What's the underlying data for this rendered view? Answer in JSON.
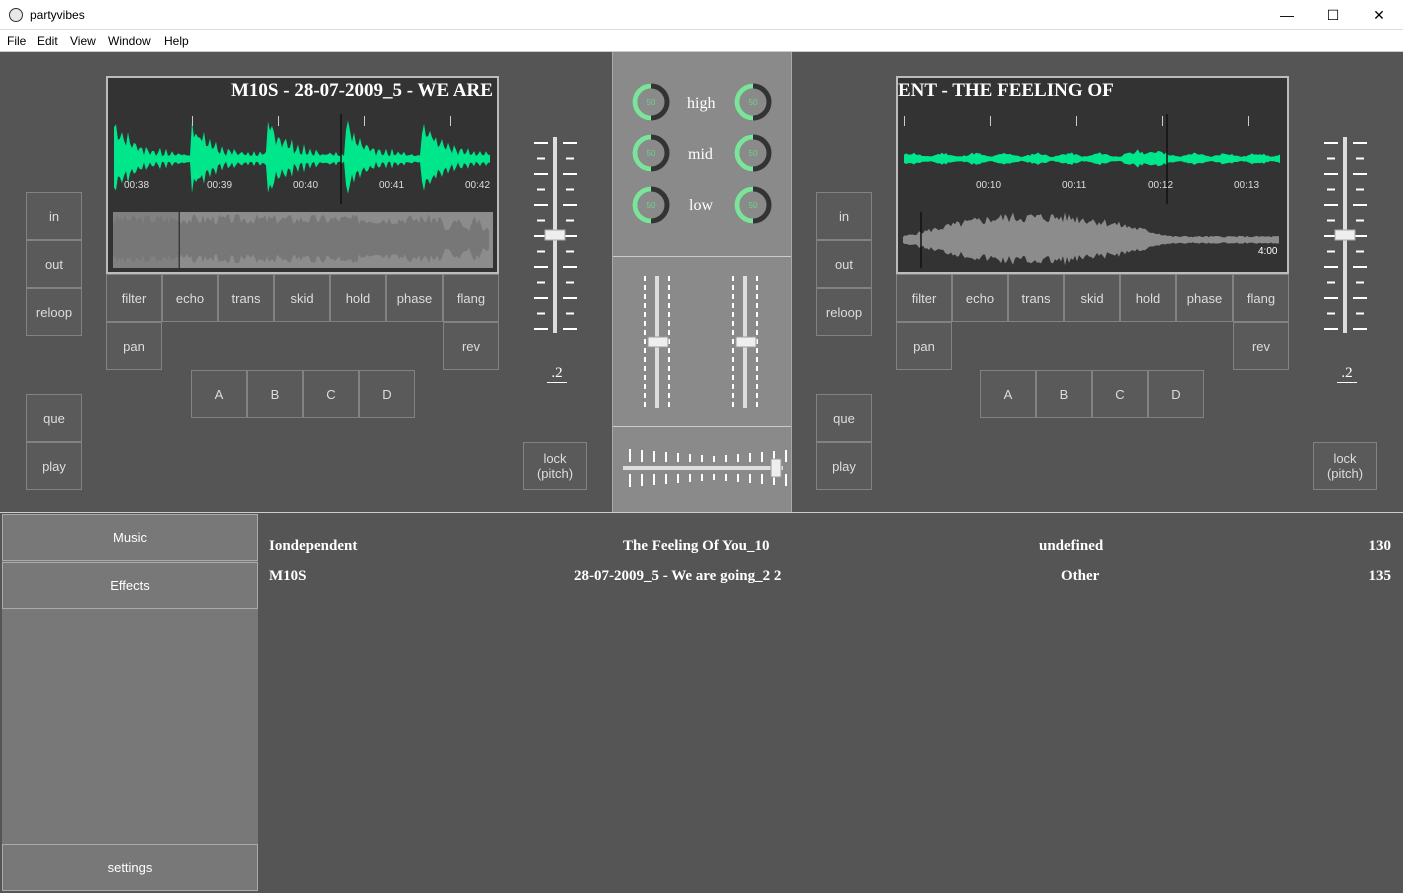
{
  "window": {
    "title": "partyvibes",
    "minimize": "—",
    "maximize": "☐",
    "close": "✕"
  },
  "menu": [
    "File",
    "Edit",
    "View",
    "Window",
    "Help"
  ],
  "deck_left": {
    "track_title": "M10S - 28-07-2009_5 - WE ARE",
    "times": [
      "00:38",
      "00:39",
      "00:40",
      "00:41",
      "00:42"
    ],
    "loop_buttons": [
      "in",
      "out",
      "reloop"
    ],
    "transport_buttons": [
      "que",
      "play"
    ],
    "effects": [
      "filter",
      "echo",
      "trans",
      "skid",
      "hold",
      "phase",
      "flang"
    ],
    "effects_row2": [
      "pan",
      "rev"
    ],
    "cues": [
      "A",
      "B",
      "C",
      "D"
    ],
    "pitch_value": ".2",
    "lock_label": "lock (pitch)"
  },
  "deck_right": {
    "track_title": "ENT - THE FEELING OF",
    "times": [
      "00:10",
      "00:11",
      "00:12",
      "00:13"
    ],
    "overview_time": "4:00",
    "loop_buttons": [
      "in",
      "out",
      "reloop"
    ],
    "transport_buttons": [
      "que",
      "play"
    ],
    "effects": [
      "filter",
      "echo",
      "trans",
      "skid",
      "hold",
      "phase",
      "flang"
    ],
    "effects_row2": [
      "pan",
      "rev"
    ],
    "cues": [
      "A",
      "B",
      "C",
      "D"
    ],
    "pitch_value": ".2",
    "lock_label": "lock (pitch)"
  },
  "mixer": {
    "eq_labels": [
      "high",
      "mid",
      "low"
    ],
    "knob_value": "50",
    "knob_color": "#7de39b"
  },
  "sidebar": {
    "tabs": [
      "Music",
      "Effects"
    ],
    "settings": "settings"
  },
  "library": [
    {
      "artist": "Iondependent",
      "title": "The Feeling Of You_10",
      "genre": "undefined",
      "bpm": "130"
    },
    {
      "artist": "M10S",
      "title": "28-07-2009_5 - We are going_2 2",
      "genre": "Other",
      "bpm": "135"
    }
  ],
  "colors": {
    "waveform": "#00e68a",
    "overview": "#8c8c8c"
  }
}
